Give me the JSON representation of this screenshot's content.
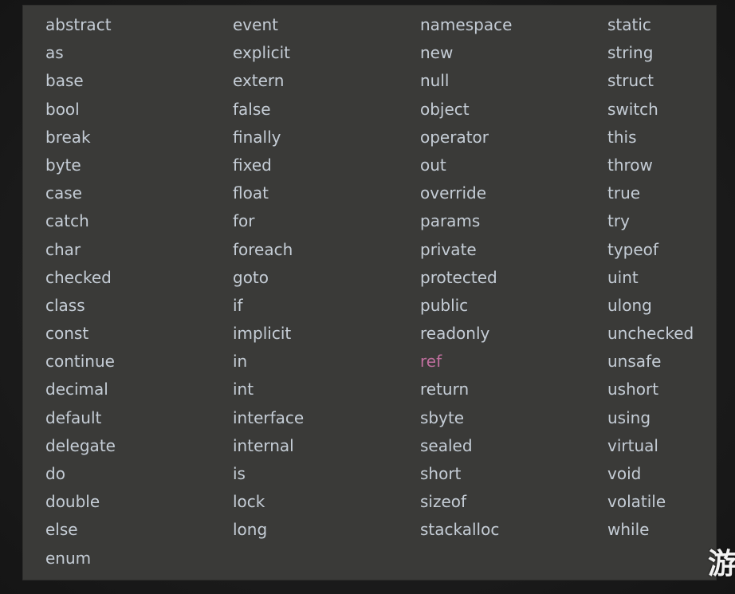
{
  "keywords": {
    "column_1": [
      "abstract",
      "as",
      "base",
      "bool",
      "break",
      "byte",
      "case",
      "catch",
      "char",
      "checked",
      "class",
      "const",
      "continue",
      "decimal",
      "default",
      "delegate",
      "do",
      "double",
      "else",
      "enum"
    ],
    "column_2": [
      "event",
      "explicit",
      "extern",
      "false",
      "finally",
      "fixed",
      "float",
      "for",
      "foreach",
      "goto",
      "if",
      "implicit",
      "in",
      "int",
      "interface",
      "internal",
      "is",
      "lock",
      "long"
    ],
    "column_3": [
      "namespace",
      "new",
      "null",
      "object",
      "operator",
      "out",
      "override",
      "params",
      "private",
      "protected",
      "public",
      "readonly",
      "ref",
      "return",
      "sbyte",
      "sealed",
      "short",
      "sizeof",
      "stackalloc"
    ],
    "column_4": [
      "static",
      "string",
      "struct",
      "switch",
      "this",
      "throw",
      "true",
      "try",
      "typeof",
      "uint",
      "ulong",
      "unchecked",
      "unsafe",
      "ushort",
      "using",
      "virtual",
      "void",
      "volatile",
      "while"
    ]
  },
  "highlighted_keyword": "ref",
  "colors": {
    "panel_background": "#3a3a38",
    "keyword_text": "#c5cdd6",
    "highlighted_text": "#c06f9e"
  },
  "watermark": "游戏"
}
